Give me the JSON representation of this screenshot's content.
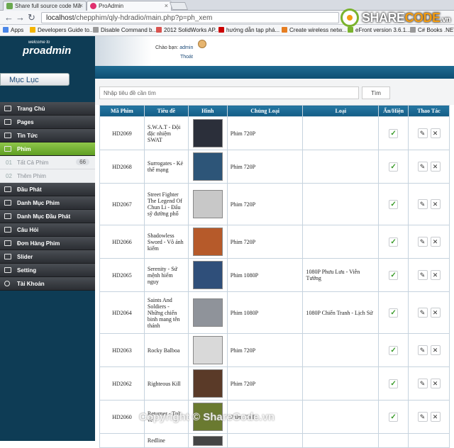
{
  "browser": {
    "tabs": [
      {
        "label": "Share full source code Mã"
      },
      {
        "label": "ProAdmin"
      }
    ],
    "url_host": "localhost",
    "url_path": "/chepphim/qly-hdradio/main.php?p=ph_xem",
    "bookmarks": [
      "Apps",
      "Developers Guide to...",
      "Disable Command b...",
      "2012 SolidWorks AP...",
      "hướng dẫn tạp phá...",
      "Create wireless netw...",
      "eFront version 3.6.1...",
      "C# Books .NET B"
    ]
  },
  "watermark_logo": {
    "part1": "SHARE",
    "part2": "CODE",
    "suffix": ".vn"
  },
  "sidebar": {
    "brand_small": "welcome to",
    "brand": "proadmin",
    "section_title": "Mục Lục",
    "items": [
      {
        "label": "Trang Chủ"
      },
      {
        "label": "Pages"
      },
      {
        "label": "Tin Tức"
      },
      {
        "label": "Phim"
      },
      {
        "label": "Tất Cả Phim",
        "num": "01",
        "badge": "66"
      },
      {
        "label": "Thêm Phim",
        "num": "02"
      },
      {
        "label": "Đầu Phát"
      },
      {
        "label": "Danh Mục Phim"
      },
      {
        "label": "Danh Mục Đầu Phát"
      },
      {
        "label": "Câu Hỏi"
      },
      {
        "label": "Đơn Hàng Phim"
      },
      {
        "label": "Slider"
      },
      {
        "label": "Setting"
      },
      {
        "label": "Tài Khoản"
      }
    ]
  },
  "header": {
    "greeting": "Chào bạn:",
    "user": "admin",
    "logout": "Thoát"
  },
  "search": {
    "placeholder": "Nhập tiêu đề cần tìm",
    "button": "Tìm"
  },
  "table": {
    "headers": [
      "Mã Phim",
      "Tiêu đề",
      "Hình",
      "Chủng Loại",
      "Loại",
      "Ẩn/Hiện",
      "Thao Tác"
    ],
    "rows": [
      {
        "id": "HD2069",
        "title": "S.W.A.T - Đội đặc nhiệm SWAT",
        "type": "Phim 720P",
        "cat": "",
        "thumb": "#2b2f3a"
      },
      {
        "id": "HD2068",
        "title": "Surrogates - Kẻ thế mạng",
        "type": "Phim 720P",
        "cat": "",
        "thumb": "#2d5578"
      },
      {
        "id": "HD2067",
        "title": "Street Fighter The Legend Of Chun Li - Đấu sỹ đường phố",
        "type": "Phim 720P",
        "cat": "",
        "thumb": "#c8c8c8"
      },
      {
        "id": "HD2066",
        "title": "Shadowless Sword - Vô ảnh kiếm",
        "type": "Phim 720P",
        "cat": "",
        "thumb": "#b65a2a"
      },
      {
        "id": "HD2065",
        "title": "Serenity - Sứ mệnh hiểm nguy",
        "type": "Phim 1080P",
        "cat": "1080P Phưu Lưu - Viễn Tưởng",
        "thumb": "#2f4f7a"
      },
      {
        "id": "HD2064",
        "title": "Saints And Soldiers - Những chiến binh mang tên thánh",
        "type": "Phim 1080P",
        "cat": "1080P Chiến Tranh - Lịch Sử",
        "thumb": "#8f939a"
      },
      {
        "id": "HD2063",
        "title": "Rocky Balboa",
        "type": "Phim 720P",
        "cat": "",
        "thumb": "#d9d9d9"
      },
      {
        "id": "HD2062",
        "title": "Righteous Kill",
        "type": "Phim 720P",
        "cat": "",
        "thumb": "#5a3a28"
      },
      {
        "id": "HD2060",
        "title": "Returner - Trở về",
        "type": "Phim 720P",
        "cat": "",
        "thumb": "#6a7a30"
      },
      {
        "id": "",
        "title": "Redline",
        "type": "",
        "cat": "",
        "thumb": "#444"
      }
    ]
  },
  "footer_watermark": "Copyright © ShareCode.vn"
}
